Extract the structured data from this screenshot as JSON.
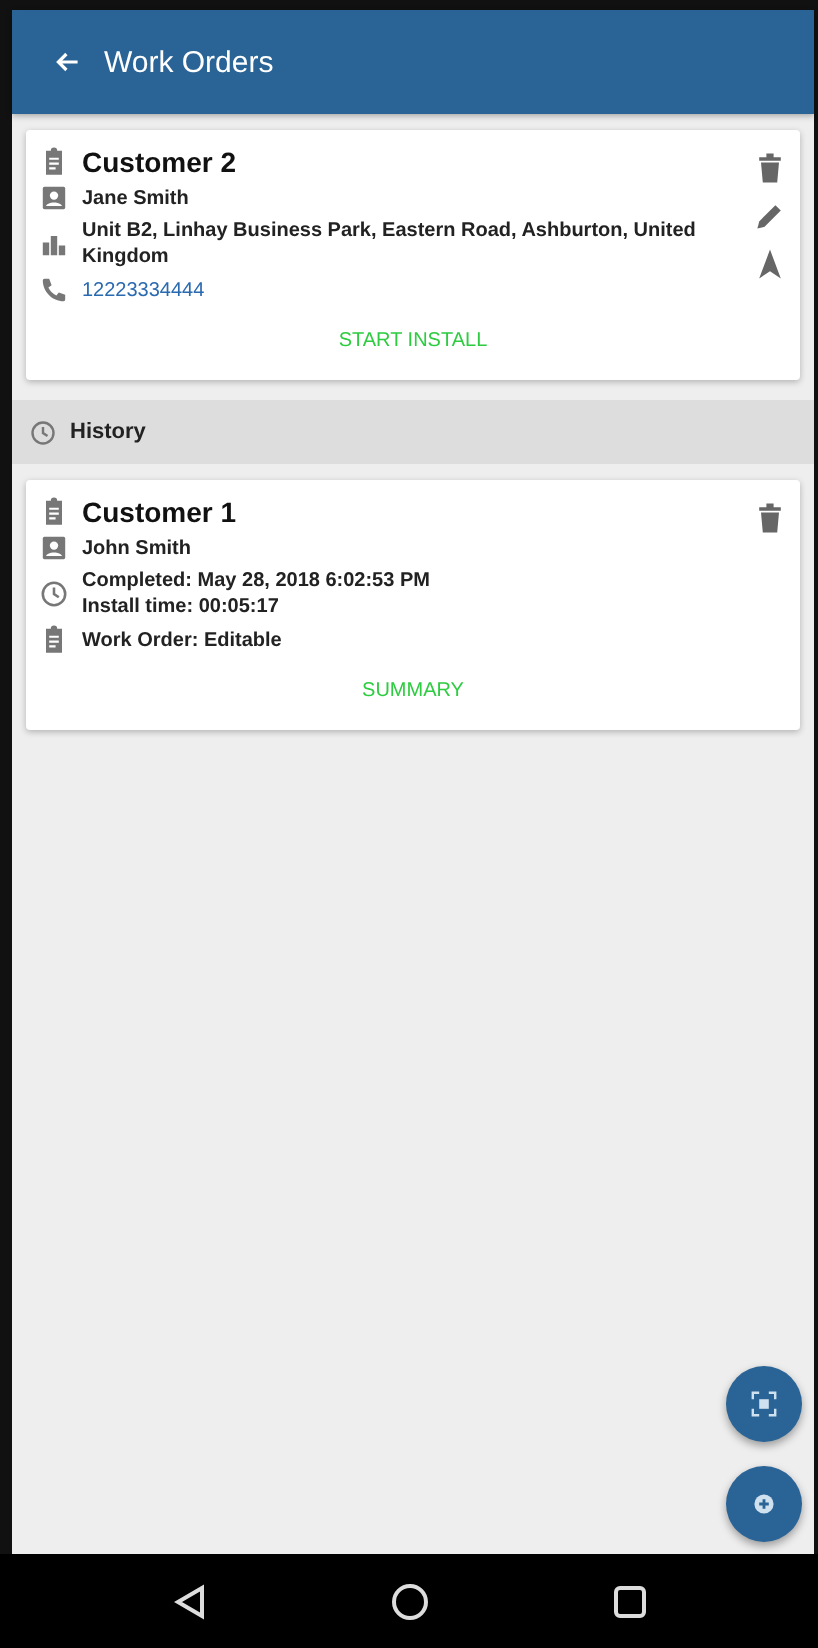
{
  "app_bar": {
    "title": "Work Orders"
  },
  "active_orders": [
    {
      "title": "Customer 2",
      "actions": [
        {
          "kind": "delete"
        },
        {
          "kind": "edit"
        },
        {
          "kind": "navigate"
        }
      ],
      "lines": [
        {
          "kind": "person",
          "text": "Jane Smith"
        },
        {
          "kind": "address",
          "text": "Unit B2, Linhay Business Park, Eastern Road, Ashburton, United Kingdom"
        },
        {
          "kind": "phone",
          "text": "12223334444"
        }
      ],
      "button": "START INSTALL"
    }
  ],
  "history": {
    "title": "History",
    "orders": [
      {
        "title": "Customer 1",
        "actions": [
          {
            "kind": "delete"
          }
        ],
        "lines": [
          {
            "kind": "person",
            "text": "John Smith"
          },
          {
            "kind": "time",
            "text": "Completed: May 28, 2018 6:02:53 PM\nInstall time: 00:05:17"
          },
          {
            "kind": "order",
            "text": "Work Order: Editable"
          }
        ],
        "button": "SUMMARY"
      }
    ]
  },
  "fabs": [
    {
      "kind": "scan"
    },
    {
      "kind": "add"
    }
  ]
}
